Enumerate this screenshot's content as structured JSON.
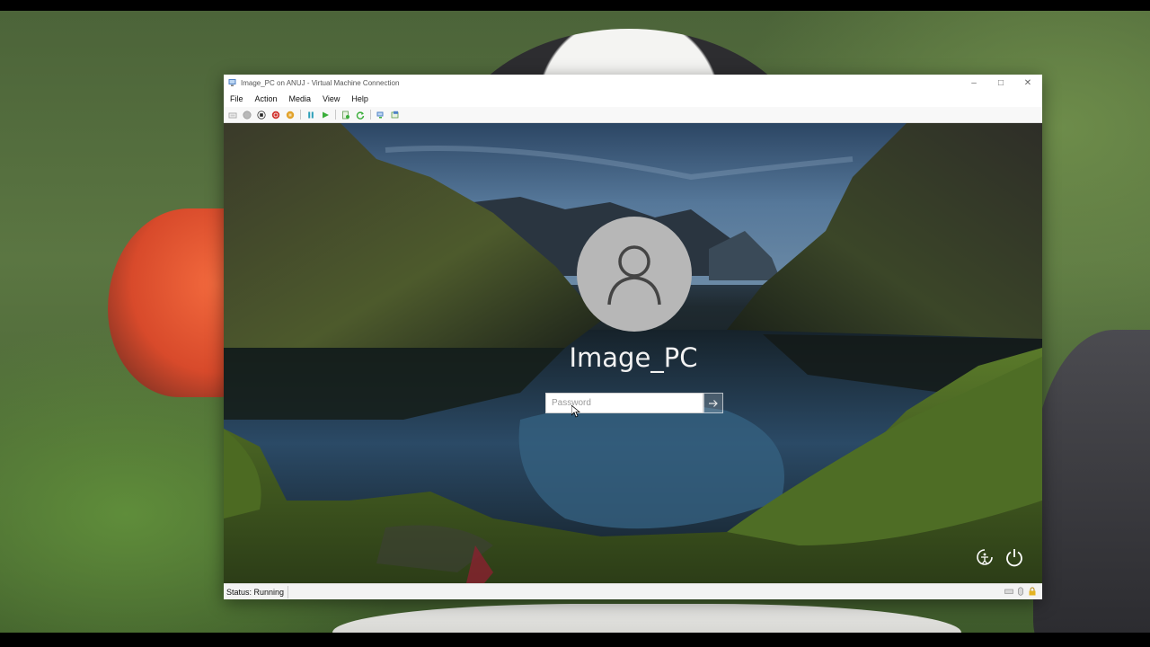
{
  "window": {
    "title": "Image_PC on ANUJ - Virtual Machine Connection",
    "controls": {
      "minimize": "–",
      "maximize": "□",
      "close": "✕"
    }
  },
  "menu": {
    "items": [
      "File",
      "Action",
      "Media",
      "View",
      "Help"
    ]
  },
  "toolbar": {
    "buttons": [
      "ctrl-alt-del-icon",
      "start-icon",
      "turn-off-icon",
      "shut-down-icon",
      "save-state-icon",
      "pause-icon",
      "resume-icon",
      "checkpoint-icon",
      "revert-icon",
      "enhanced-session-icon",
      "share-icon"
    ]
  },
  "lock_screen": {
    "user_name": "Image_PC",
    "password_placeholder": "Password",
    "submit_icon": "arrow-right-icon",
    "accessibility_icon": "accessibility-icon",
    "power_icon": "power-icon"
  },
  "status_bar": {
    "status_text": "Status: Running",
    "icons": [
      "keyboard-icon",
      "mouse-icon",
      "lock-icon"
    ]
  },
  "colors": {
    "window_bg": "#f3f3f3",
    "avatar_bg": "#b7b7b7",
    "stop_red": "#d1332e",
    "save_orange": "#e2a22a",
    "pause_teal": "#2c9fb8",
    "resume_green": "#3aae3a"
  }
}
